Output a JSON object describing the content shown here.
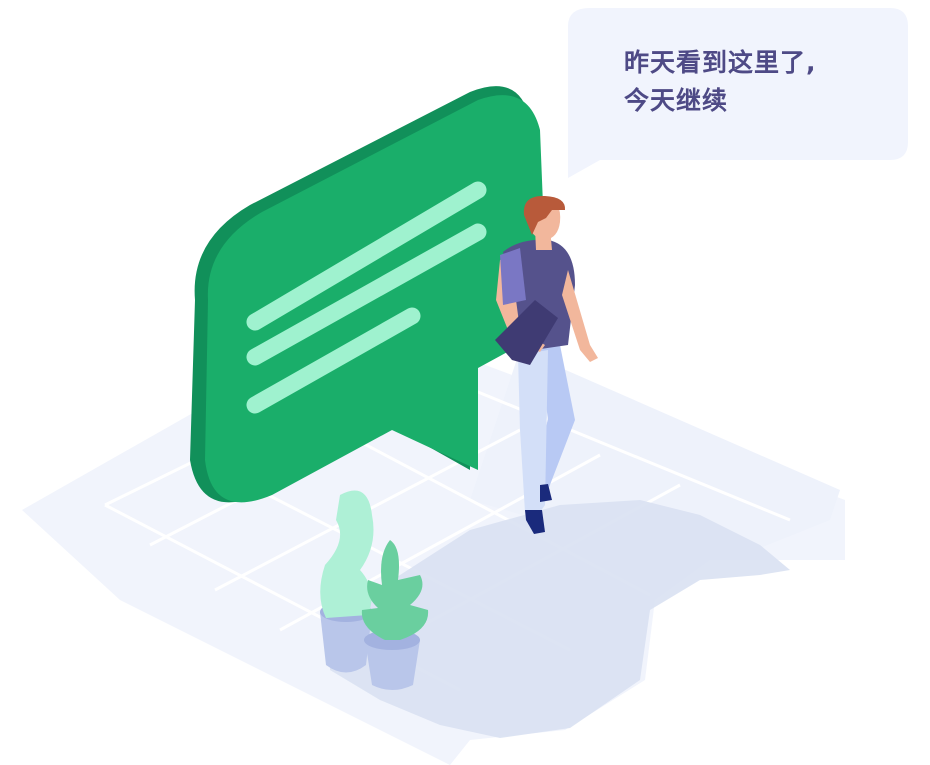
{
  "speech_bubble": {
    "line1": "昨天看到这里了,",
    "line2": "今天继续"
  },
  "icons": {
    "chat": "chat-bubble-icon",
    "person": "walking-person",
    "plant": "potted-plant"
  },
  "colors": {
    "floor": "#eef2fb",
    "floor_shadow": "#d9e1f2",
    "bubble_green": "#1aae6a",
    "bubble_green_dark": "#11905a",
    "bubble_lines": "#9ff2cf",
    "speech_bg": "#f1f4fd",
    "speech_text": "#4e4a86",
    "shirt": "#55528c",
    "pants": "#c9d8f7",
    "hair": "#b85a3a",
    "skin": "#f2b79c",
    "plant_light": "#aef0d6",
    "plant_dark": "#6acf9f",
    "pot": "#b9c6ea"
  }
}
